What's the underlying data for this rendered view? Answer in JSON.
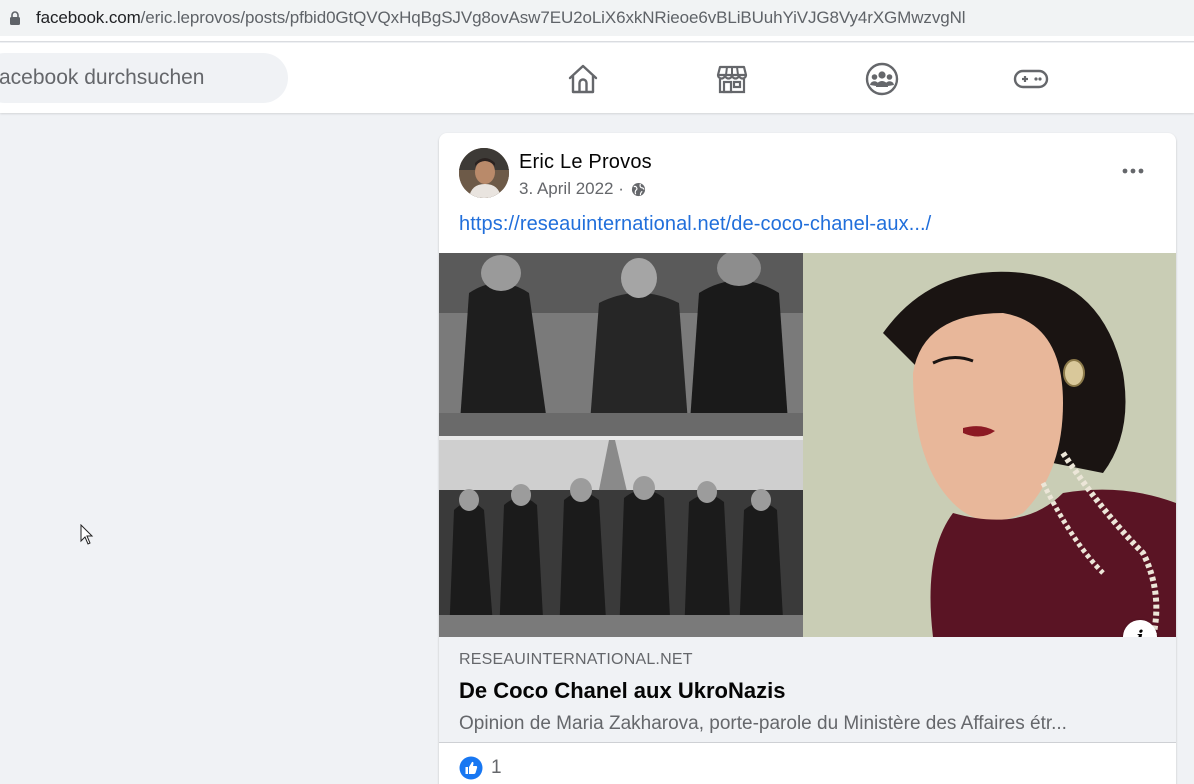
{
  "browser": {
    "url_host": "facebook.com",
    "url_path": "/eric.leprovos/posts/pfbid0GtQVQxHqBgSJVg8ovAsw7EU2oLiX6xkNRieoe6vBLiBUuhYiVJG8Vy4rXGMwzvgNl"
  },
  "header": {
    "search_placeholder": "acebook durchsuchen",
    "nav_icons": [
      "home-icon",
      "marketplace-icon",
      "groups-icon",
      "gaming-icon"
    ]
  },
  "post": {
    "author": "Eric Le Provos",
    "date": "3. April 2022 ·",
    "link_text": "https://reseauinternational.net/de-coco-chanel-aux.../",
    "link_domain": "RESEAUINTERNATIONAL.NET",
    "link_title": "De Coco Chanel aux UkroNazis",
    "link_description": "Opinion de Maria Zakharova, porte-parole du Ministère des Affaires étr...",
    "reaction_count": "1"
  },
  "colors": {
    "accent": "#216fdb",
    "background": "#f0f2f5",
    "icon_gray": "#65676b"
  }
}
